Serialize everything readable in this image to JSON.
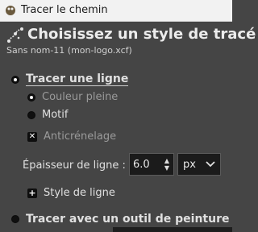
{
  "window": {
    "title": "Tracer le chemin"
  },
  "header": {
    "title": "Choisissez un style de tracé",
    "subtitle": "Sans nom-11 (mon-logo.xcf)"
  },
  "options": {
    "stroke_line": "Tracer une ligne",
    "solid_color": "Couleur pleine",
    "pattern": "Motif",
    "antialiasing": "Anticrénelage",
    "line_width_label": "Épaisseur de ligne :",
    "line_width_value": "6.0",
    "unit": "px",
    "line_style": "Style de ligne",
    "paint_tool": "Tracer avec un outil de peinture"
  }
}
